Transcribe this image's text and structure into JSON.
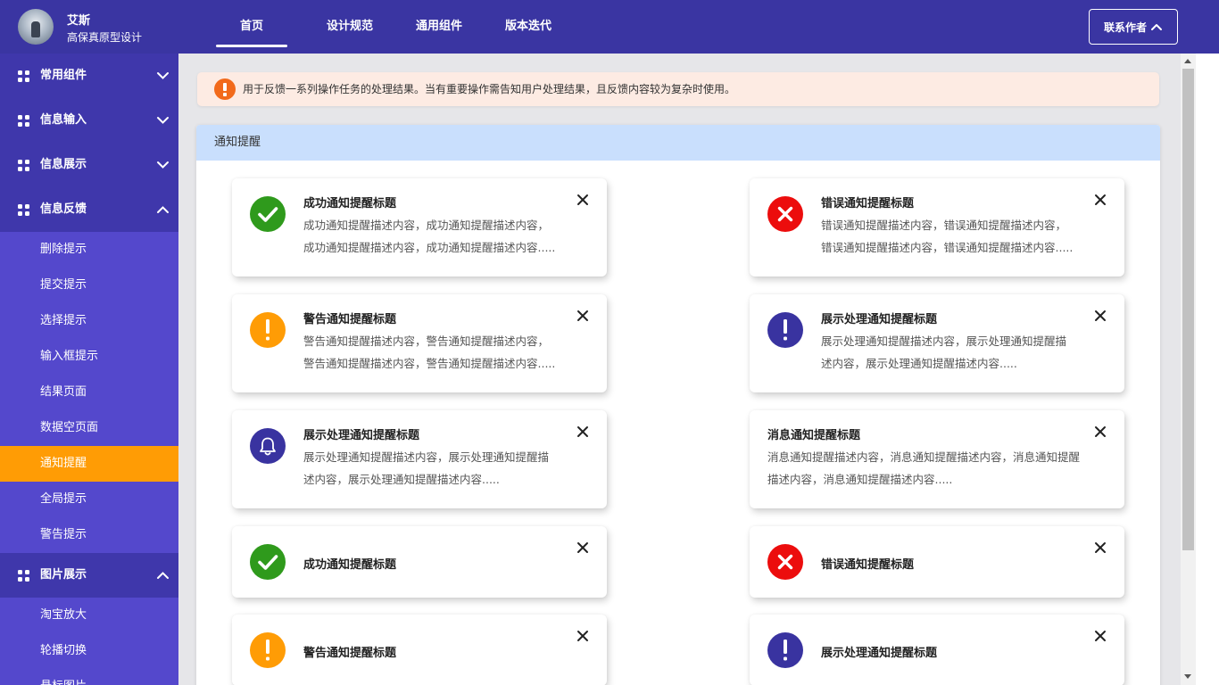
{
  "header": {
    "user_name": "艾斯",
    "subtitle": "高保真原型设计",
    "nav": [
      "首页",
      "设计规范",
      "通用组件",
      "版本迭代"
    ],
    "contact_label": "联系作者"
  },
  "sidebar": {
    "groups": [
      {
        "label": "常用组件",
        "expanded": false
      },
      {
        "label": "信息输入",
        "expanded": false
      },
      {
        "label": "信息展示",
        "expanded": false
      },
      {
        "label": "信息反馈",
        "expanded": true
      },
      {
        "label": "图片展示",
        "expanded": true
      }
    ],
    "feedback_items": [
      "删除提示",
      "提交提示",
      "选择提示",
      "输入框提示",
      "结果页面",
      "数据空页面",
      "通知提醒",
      "全局提示",
      "警告提示"
    ],
    "image_items": [
      "淘宝放大",
      "轮播切换",
      "悬标图片"
    ],
    "active_item": "通知提醒"
  },
  "alert": {
    "text": "用于反馈一系列操作任务的处理结果。当有重要操作需告知用户处理结果，且反馈内容较为复杂时使用。",
    "icon": "warning-circle-icon"
  },
  "panel": {
    "title": "通知提醒"
  },
  "cards": [
    {
      "type": "success",
      "icon": "check-icon",
      "title": "成功通知提醒标题",
      "desc": "成功通知提醒描述内容，成功通知提醒描述内容，\n成功通知提醒描述内容，成功通知提醒描述内容....."
    },
    {
      "type": "error",
      "icon": "cross-icon",
      "title": "错误通知提醒标题",
      "desc": "错误通知提醒描述内容，错误通知提醒描述内容，\n错误通知提醒描述内容，错误通知提醒描述内容....."
    },
    {
      "type": "warning",
      "icon": "exclamation-icon",
      "title": "警告通知提醒标题",
      "desc": "警告通知提醒描述内容，警告通知提醒描述内容，\n警告通知提醒描述内容，警告通知提醒描述内容....."
    },
    {
      "type": "info",
      "icon": "exclamation-icon",
      "title": "展示处理通知提醒标题",
      "desc": "展示处理通知提醒描述内容，展示处理通知提醒描\n述内容，展示处理通知提醒描述内容....."
    },
    {
      "type": "bell",
      "icon": "bell-icon",
      "title": "展示处理通知提醒标题",
      "desc": "展示处理通知提醒描述内容，展示处理通知提醒描\n述内容，展示处理通知提醒描述内容....."
    },
    {
      "type": "none",
      "icon": "",
      "title": "消息通知提醒标题",
      "desc": "消息通知提醒描述内容，消息通知提醒描述内容，消息通知提醒\n描述内容，消息通知提醒描述内容....."
    },
    {
      "type": "success",
      "icon": "check-icon",
      "title": "成功通知提醒标题",
      "desc": ""
    },
    {
      "type": "error",
      "icon": "cross-icon",
      "title": "错误通知提醒标题",
      "desc": ""
    },
    {
      "type": "warning",
      "icon": "exclamation-icon",
      "title": "警告通知提醒标题",
      "desc": ""
    },
    {
      "type": "info",
      "icon": "exclamation-icon",
      "title": "展示处理通知提醒标题",
      "desc": ""
    }
  ],
  "colors": {
    "header_bg": "#3a35a2",
    "sidebar_bg": "#5448cc",
    "sidebar_group_bg": "#3f37ab",
    "active_item": "#ff9c05",
    "success": "#2f9a1c",
    "error": "#ec0d0d",
    "warning": "#ff9c05",
    "info": "#3933a0",
    "panel_header": "#c9dffd",
    "alert_bg": "#fdebe3"
  }
}
